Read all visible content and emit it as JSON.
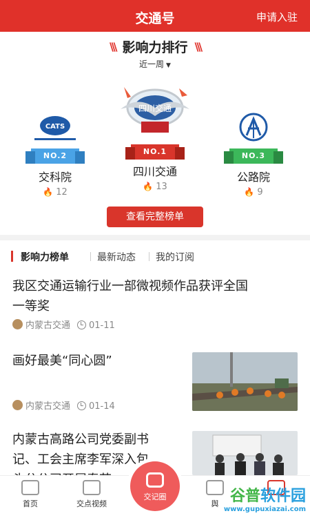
{
  "header": {
    "title": "交通号",
    "apply": "申请入驻"
  },
  "ranking": {
    "title": "影响力排行",
    "period": "近一周",
    "entries": [
      {
        "rank_label": "NO.1",
        "name": "四川交通",
        "score": "13",
        "logo_text": "四川交通"
      },
      {
        "rank_label": "NO.2",
        "name": "交科院",
        "score": "12",
        "logo_text": "CATS"
      },
      {
        "rank_label": "NO.3",
        "name": "公路院",
        "score": "9"
      }
    ],
    "full_list_button": "查看完整榜单"
  },
  "tabs": [
    "影响力榜单",
    "最新动态",
    "我的订阅"
  ],
  "news": [
    {
      "title_line1": "我区交通运输行业一部微视频作品获评全国",
      "title_line2": "一等奖",
      "source": "内蒙古交通",
      "date": "01-11"
    },
    {
      "title": "画好最美“同心圆”",
      "source": "内蒙古交通",
      "date": "01-14"
    },
    {
      "title_line1": "内蒙古高路公司党委副书",
      "title_line2": "记、工会主席李军深入包",
      "title_line3": "头分公司开展春节"
    }
  ],
  "bottom_nav": {
    "home": "首页",
    "video": "交点视频",
    "center": "交记圈",
    "fourth": "舆"
  },
  "watermark": {
    "brand_a": "谷普",
    "brand_b": "软件园",
    "url": "www.gupuxiazai.com"
  }
}
